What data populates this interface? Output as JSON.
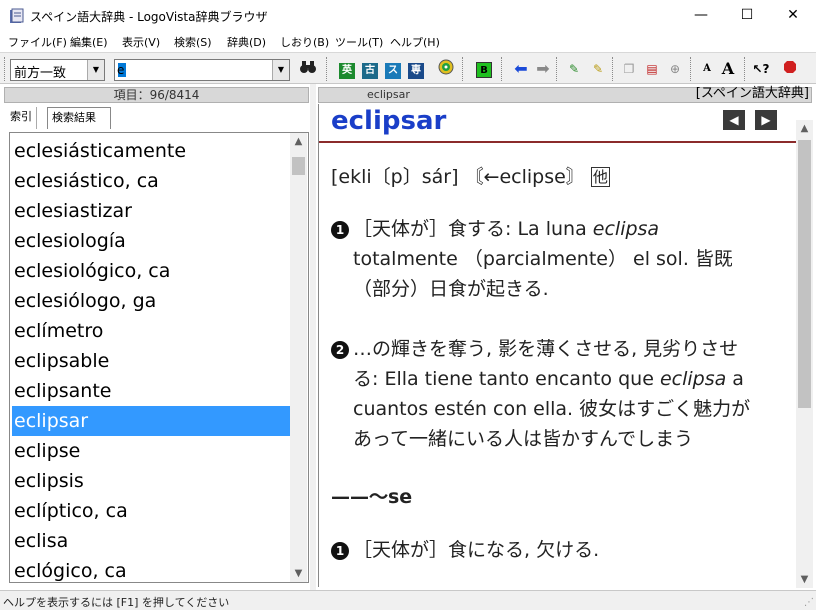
{
  "window": {
    "title": "スペイン語大辞典 - LogoVista辞典ブラウザ",
    "minimize": "—",
    "maximize": "☐",
    "close": "✕"
  },
  "menu": [
    {
      "label": "ファイル(F)"
    },
    {
      "label": "編集(E)"
    },
    {
      "label": "表示(V)"
    },
    {
      "label": "検索(S)"
    },
    {
      "label": "辞典(D)"
    },
    {
      "label": "しおり(B)"
    },
    {
      "label": "ツール(T)"
    },
    {
      "label": "ヘルプ(H)"
    }
  ],
  "toolbar": {
    "search_mode": "前方一致",
    "search_value": "e",
    "icons": [
      "binoculars-icon",
      "dictionary-icon",
      "classic-dictionary-icon",
      "x-icon",
      "kanji-icon",
      "cd-icon",
      "bookmark-icon",
      "back-arrow-icon",
      "forward-arrow-icon",
      "highlighter-icon",
      "marker-icon",
      "copy-icon",
      "history-icon",
      "zoom-icon",
      "font-smaller-icon",
      "font-larger-icon",
      "help-pointer-icon",
      "stop-icon"
    ]
  },
  "left_pane": {
    "header": "項目：96/8414",
    "tabs": [
      {
        "label": "索引"
      },
      {
        "label": "検索結果"
      }
    ],
    "items": [
      "eclesiásticamente",
      "eclesiástico, ca",
      "eclesiastizar",
      "eclesiología",
      "eclesiológico, ca",
      "eclesiólogo, ga",
      "eclímetro",
      "eclipsable",
      "eclipsante",
      "eclipsar",
      "eclipse",
      "eclipsis",
      "eclíptico, ca",
      "eclisa",
      "eclógico, ca"
    ],
    "selected_index": 9
  },
  "right_pane": {
    "header_word": "eclipsar",
    "dictionary_name": "[スペイン語大辞典]",
    "headword": "eclipsar",
    "pronunciation": "[ekli〔p〕sár]",
    "etymology": "〘←eclipse〙",
    "other_tag": "他",
    "sense1_num": "1",
    "sense1_label": "［天体が］食する:",
    "sense1_line1_a": "La luna ",
    "sense1_line1_b": "eclipsa",
    "sense1_line2": "totalmente （parcialmente） el sol. 皆既",
    "sense1_line3": "（部分）日食が起きる.",
    "sense2_num": "2",
    "sense2_line1": "…の輝きを奪う, 影を薄くさせる, 見劣りさせ",
    "sense2_line2_a": "る: Ella tiene tanto encanto que ",
    "sense2_line2_b": "eclipsa",
    "sense2_line2_c": " a",
    "sense2_line3": "cuantos estén con ella. 彼女はすごく魅力が",
    "sense2_line4": "あって一緒にいる人は皆かすんでしまう",
    "phrase": "——～se",
    "sense3_num": "1",
    "sense3_line1": "［天体が］食になる, 欠ける."
  },
  "status": {
    "text": "ヘルプを表示するには [F1] を押してください"
  },
  "colors": {
    "headword": "#1a3ec8",
    "selection": "#3399ff",
    "rule": "#8b2b2b"
  }
}
